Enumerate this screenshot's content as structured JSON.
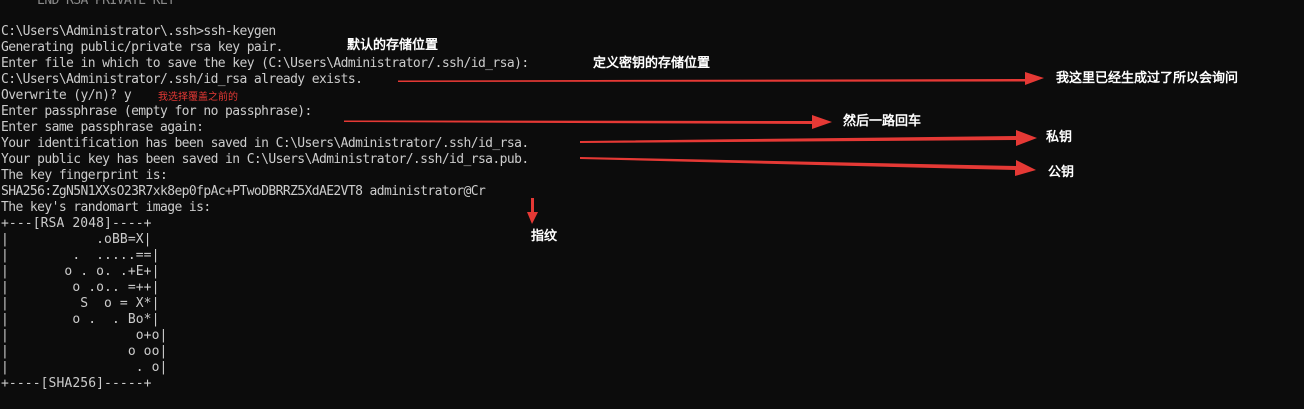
{
  "terminal": {
    "lines": {
      "top_cut": "     END RSA PRIVATE KEY",
      "cmd": "C:\\Users\\Administrator\\.ssh>ssh-keygen",
      "generating": "Generating public/private rsa key pair.",
      "enter_file": "Enter file in which to save the key (C:\\Users\\Administrator/.ssh/id_rsa):",
      "exists": "C:\\Users\\Administrator/.ssh/id_rsa already exists.",
      "overwrite": "Overwrite (y/n)? y",
      "passphrase": "Enter passphrase (empty for no passphrase):",
      "same_passphrase": "Enter same passphrase again:",
      "identification": "Your identification has been saved in C:\\Users\\Administrator/.ssh/id_rsa.",
      "public_key": "Your public key has been saved in C:\\Users\\Administrator/.ssh/id_rsa.pub.",
      "fingerprint_label": "The key fingerprint is:",
      "fingerprint": "SHA256:ZgN5N1XXsO23R7xk8ep0fpAc+PTwoDBRRZ5XdAE2VT8 administrator@Cr",
      "randomart_label": "The key's randomart image is:",
      "art_top": "+---[RSA 2048]----+",
      "art_1": "|           .oBB=X|",
      "art_2": "|        .  .....==|",
      "art_3": "|       o . o. .+E+|",
      "art_4": "|        o .o.. =++|",
      "art_5": "|         S  o = X*|",
      "art_6": "|        o .  . Bo*|",
      "art_7": "|                o+o|",
      "art_8": "|               o oo|",
      "art_9": "|                . o|",
      "art_bottom": "+----[SHA256]-----+",
      "bottom_cut": "                       ."
    }
  },
  "annotations": {
    "default_location": "默认的存储位置",
    "custom_location": "定义密钥的存储位置",
    "already_generated": "我这里已经生成过了所以会询问",
    "overwrite_choice": "我选择覆盖之前的",
    "press_enter": "然后一路回车",
    "private_key": "私钥",
    "public_key": "公钥",
    "fingerprint": "指纹"
  },
  "colors": {
    "background": "#0c0c0c",
    "terminal_text": "#cccccc",
    "annotation_text": "#ffffff",
    "arrow": "#e53935"
  },
  "icons": {
    "arrow": "arrow-right-icon",
    "arrow_down": "arrow-down-icon"
  }
}
